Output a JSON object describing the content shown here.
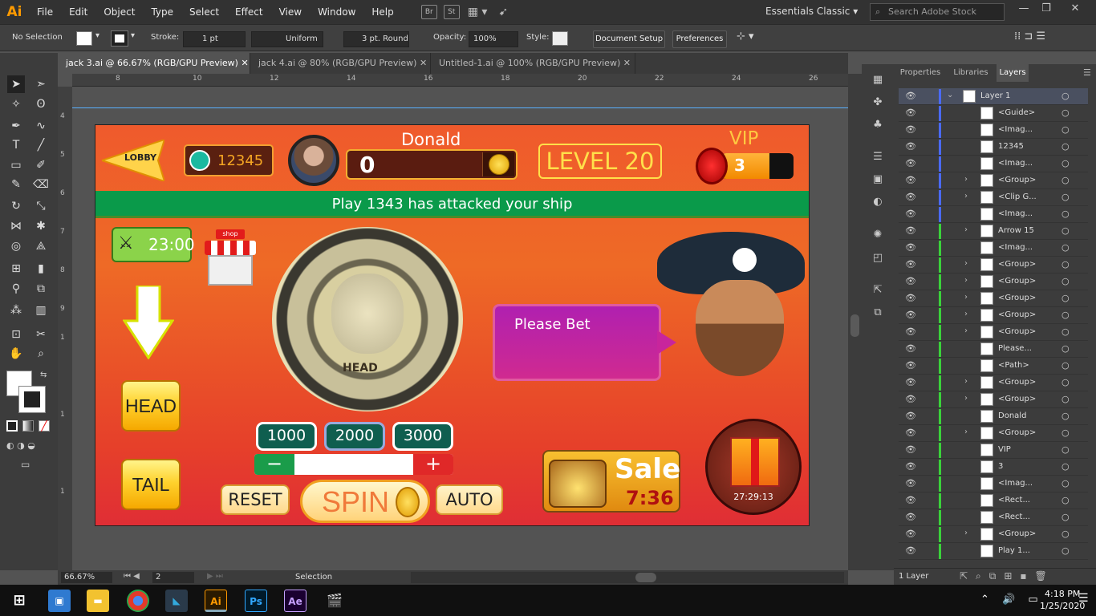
{
  "app": {
    "logo": "Ai"
  },
  "menu": [
    "File",
    "Edit",
    "Object",
    "Type",
    "Select",
    "Effect",
    "View",
    "Window",
    "Help"
  ],
  "menu_extras": {
    "br": "Br",
    "st": "St"
  },
  "workspace": "Essentials Classic",
  "search_placeholder": "Search Adobe Stock",
  "control": {
    "selection": "No Selection",
    "stroke_label": "Stroke:",
    "stroke_value": "1 pt",
    "profile": "Uniform",
    "brush": "3 pt. Round",
    "opacity_label": "Opacity:",
    "opacity_value": "100%",
    "style_label": "Style:",
    "document_setup": "Document Setup",
    "preferences": "Preferences"
  },
  "tabs": [
    {
      "label": "jack 3.ai @ 66.67% (RGB/GPU Preview)"
    },
    {
      "label": "jack 4.ai @ 80% (RGB/GPU Preview)"
    },
    {
      "label": "Untitled-1.ai @ 100% (RGB/GPU Preview)"
    }
  ],
  "ruler_top": [
    "8",
    "10",
    "12",
    "14",
    "16",
    "18",
    "20",
    "22",
    "24",
    "26"
  ],
  "ruler_left": [
    "4",
    "5",
    "6",
    "7",
    "8",
    "9",
    "1",
    "1",
    "1"
  ],
  "status": {
    "zoom": "66.67%",
    "artboard": "2",
    "tool": "Selection"
  },
  "panel_tabs": [
    "Properties",
    "Libraries",
    "Layers"
  ],
  "layers": [
    {
      "name": "Layer 1",
      "twirl": "v",
      "color": "#4a6aff"
    },
    {
      "name": "<Guide>",
      "twirl": "",
      "color": "#4a6aff"
    },
    {
      "name": "<Imag...",
      "twirl": "",
      "color": "#4a6aff"
    },
    {
      "name": "12345",
      "twirl": "",
      "color": "#4a6aff"
    },
    {
      "name": "<Imag...",
      "twirl": "",
      "color": "#4a6aff"
    },
    {
      "name": "<Group>",
      "twirl": ">",
      "color": "#4a6aff"
    },
    {
      "name": "<Clip G...",
      "twirl": ">",
      "color": "#4a6aff"
    },
    {
      "name": "<Imag...",
      "twirl": "",
      "color": "#4a6aff"
    },
    {
      "name": "Arrow 15",
      "twirl": ">",
      "color": "#3ad23a"
    },
    {
      "name": "<Imag...",
      "twirl": "",
      "color": "#3ad23a"
    },
    {
      "name": "<Group>",
      "twirl": ">",
      "color": "#3ad23a"
    },
    {
      "name": "<Group>",
      "twirl": ">",
      "color": "#3ad23a"
    },
    {
      "name": "<Group>",
      "twirl": ">",
      "color": "#3ad23a"
    },
    {
      "name": "<Group>",
      "twirl": ">",
      "color": "#3ad23a"
    },
    {
      "name": "<Group>",
      "twirl": ">",
      "color": "#3ad23a"
    },
    {
      "name": "Please...",
      "twirl": "",
      "color": "#3ad23a"
    },
    {
      "name": "<Path>",
      "twirl": "",
      "color": "#3ad23a"
    },
    {
      "name": "<Group>",
      "twirl": ">",
      "color": "#3ad23a"
    },
    {
      "name": "<Group>",
      "twirl": ">",
      "color": "#3ad23a"
    },
    {
      "name": "Donald",
      "twirl": "",
      "color": "#3ad23a"
    },
    {
      "name": "<Group>",
      "twirl": ">",
      "color": "#3ad23a"
    },
    {
      "name": "VIP",
      "twirl": "",
      "color": "#3ad23a"
    },
    {
      "name": "3",
      "twirl": "",
      "color": "#3ad23a"
    },
    {
      "name": "<Imag...",
      "twirl": "",
      "color": "#3ad23a"
    },
    {
      "name": "<Rect...",
      "twirl": "",
      "color": "#3ad23a"
    },
    {
      "name": "<Rect...",
      "twirl": "",
      "color": "#3ad23a"
    },
    {
      "name": "<Group>",
      "twirl": ">",
      "color": "#3ad23a"
    },
    {
      "name": "Play 1...",
      "twirl": "",
      "color": "#3ad23a"
    }
  ],
  "layers_footer": "1 Layer",
  "game": {
    "lobby": "LOBBY",
    "player_id": "12345",
    "player_name": "Donald",
    "coins": "0",
    "level": "LEVEL 20",
    "vip_label": "VIP",
    "vip_level": "3",
    "banner": "Play 1343 has attacked your ship",
    "timer": "23:00",
    "shop_label": "shop",
    "coin_text": "HEAD",
    "bubble": "Please Bet",
    "head_btn": "HEAD",
    "tail_btn": "TAIL",
    "bets": [
      "1000",
      "2000",
      "3000"
    ],
    "minus": "−",
    "plus": "+",
    "reset": "RESET",
    "spin": "SPIN",
    "auto": "AUTO",
    "sale": "Sale",
    "sale_timer": "7:36",
    "gift_timer": "27:29:13"
  },
  "taskbar": {
    "time": "4:18 PM",
    "date": "1/25/2020",
    "apps": [
      "Ai",
      "Ps",
      "Ae"
    ]
  }
}
